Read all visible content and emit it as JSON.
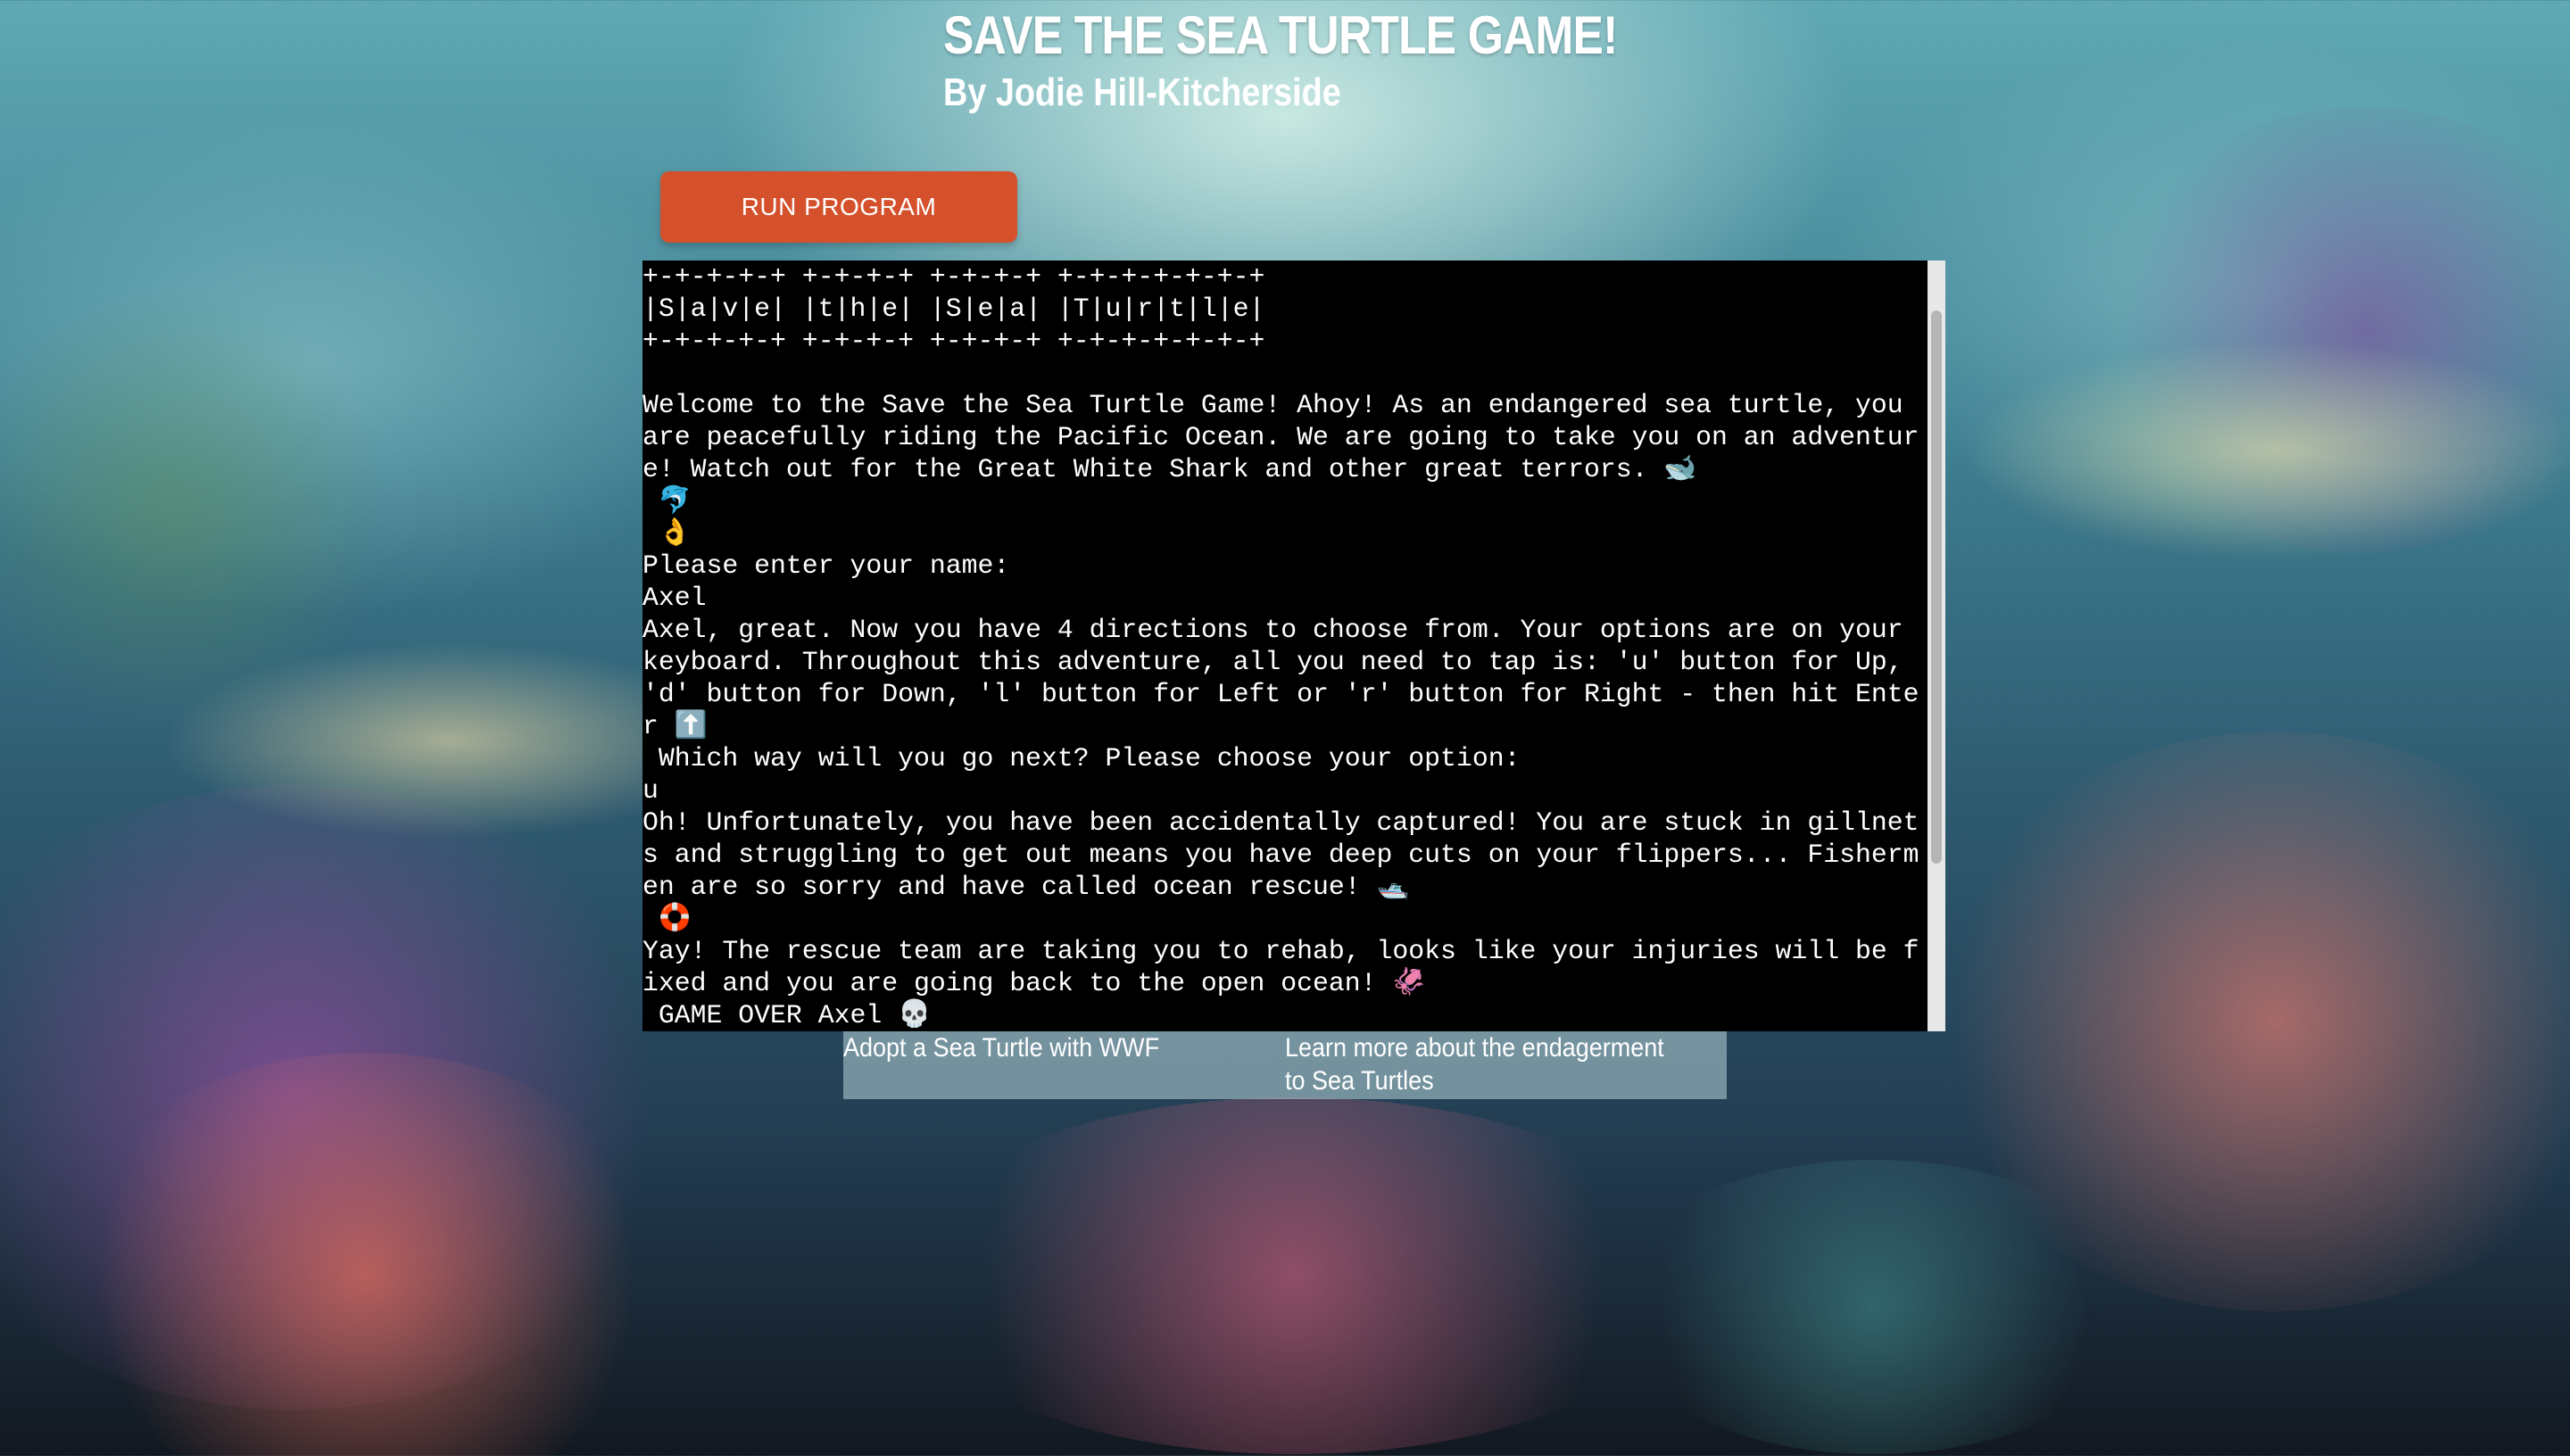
{
  "header": {
    "title": "SAVE THE SEA TURTLE GAME!",
    "subtitle": "By Jodie Hill-Kitcherside"
  },
  "controls": {
    "run_button_label": "RUN PROGRAM"
  },
  "terminal": {
    "lines": [
      "+-+-+-+-+ +-+-+-+ +-+-+-+ +-+-+-+-+-+-+",
      "|S|a|v|e| |t|h|e| |S|e|a| |T|u|r|t|l|e|",
      "+-+-+-+-+ +-+-+-+ +-+-+-+ +-+-+-+-+-+-+",
      "",
      "Welcome to the Save the Sea Turtle Game! Ahoy! As an endangered sea turtle, you",
      "are peacefully riding the Pacific Ocean. We are going to take you on an adventur",
      "e! Watch out for the Great White Shark and other great terrors. 🐋",
      " 🐬",
      " 👌",
      "Please enter your name:",
      "Axel",
      "Axel, great. Now you have 4 directions to choose from. Your options are on your",
      "keyboard. Throughout this adventure, all you need to tap is: 'u' button for Up,",
      "'d' button for Down, 'l' button for Left or 'r' button for Right - then hit Ente",
      "r ⬆️",
      " Which way will you go next? Please choose your option:",
      "u",
      "Oh! Unfortunately, you have been accidentally captured! You are stuck in gillnet",
      "s and struggling to get out means you have deep cuts on your flippers... Fisherm",
      "en are so sorry and have called ocean rescue! 🛥️",
      " 🛟",
      "Yay! The rescue team are taking you to rehab, looks like your injuries will be f",
      "ixed and you are going back to the open ocean! 🦑",
      " GAME OVER Axel 💀"
    ]
  },
  "links": {
    "adopt": "Adopt a Sea Turtle with WWF",
    "learn": "Learn more about the endagerment to Sea Turtles"
  },
  "colors": {
    "run_button": "#d5512c",
    "terminal_bg": "#000000",
    "terminal_text": "#ffffff"
  }
}
